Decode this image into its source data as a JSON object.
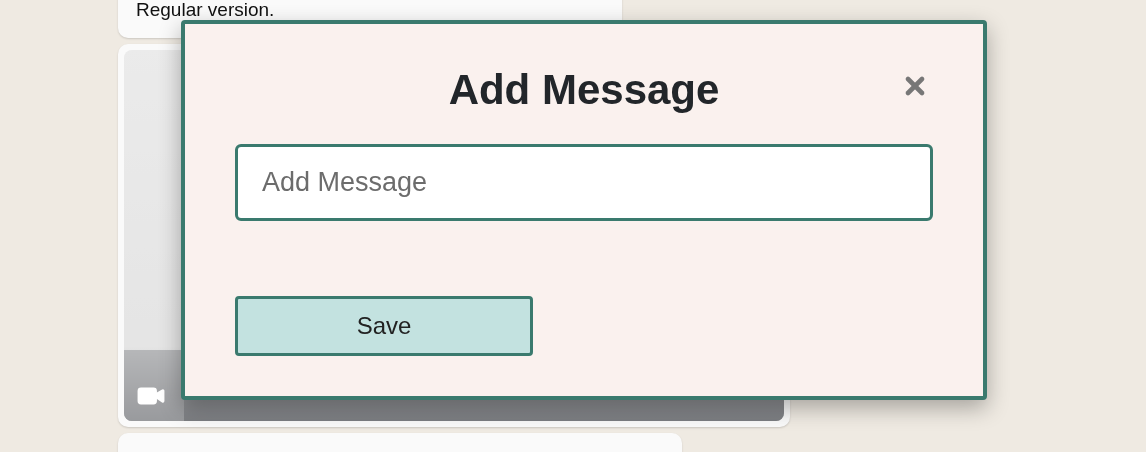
{
  "chat": {
    "messages": [
      {
        "kind": "text",
        "text": "Regular version."
      },
      {
        "kind": "video"
      },
      {
        "kind": "text"
      }
    ]
  },
  "modal": {
    "title": "Add Message",
    "input": {
      "placeholder": "Add Message"
    },
    "button": "Save"
  }
}
